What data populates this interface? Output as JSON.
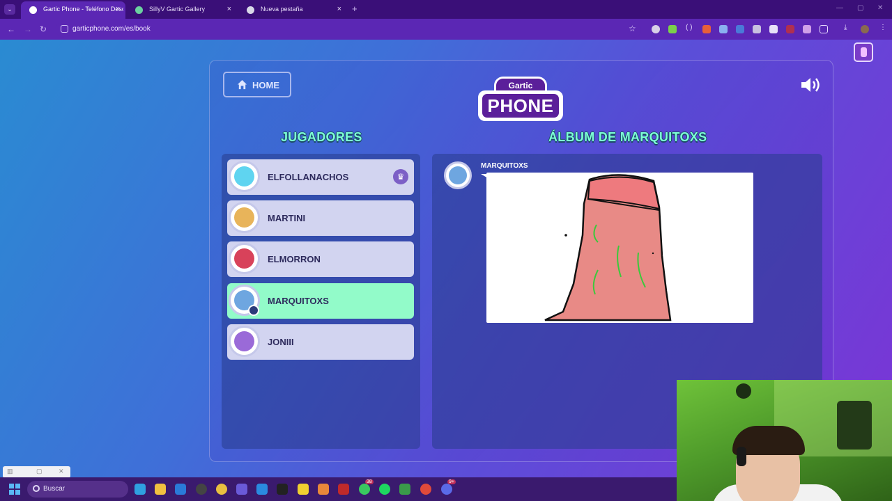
{
  "browser": {
    "tabs": [
      {
        "title": "Gartic Phone - Teléfono Descon",
        "active": true
      },
      {
        "title": "SillyV Gartic Gallery",
        "active": false
      },
      {
        "title": "Nueva pestaña",
        "active": false
      }
    ],
    "url": "garticphone.com/es/book",
    "new_tab_symbol": "+"
  },
  "game": {
    "home_label": "HOME",
    "logo_top": "Gartic",
    "logo_main": "PHONE",
    "players_heading": "JUGADORES",
    "album_heading": "ÁLBUM DE MARQUITOXS",
    "players": [
      {
        "name": "ELFOLLANACHOS",
        "host": true,
        "avatar_color": "#5fd4f0"
      },
      {
        "name": "MARTINI",
        "avatar_color": "#e8b45a"
      },
      {
        "name": "ELMORRON",
        "avatar_color": "#d8425a"
      },
      {
        "name": "MARQUITOXS",
        "active": true,
        "avatar_color": "#6ea6e0"
      },
      {
        "name": "JONIII",
        "avatar_color": "#9a6ad8"
      }
    ],
    "album_entry_author": "MARQUITOXS"
  },
  "taskbar": {
    "search_placeholder": "Buscar",
    "badges": [
      "38",
      "9+"
    ]
  },
  "colors": {
    "accent_heading": "#7dffd6",
    "active_player": "#92fbc9",
    "player_card": "#d2d4f0"
  }
}
